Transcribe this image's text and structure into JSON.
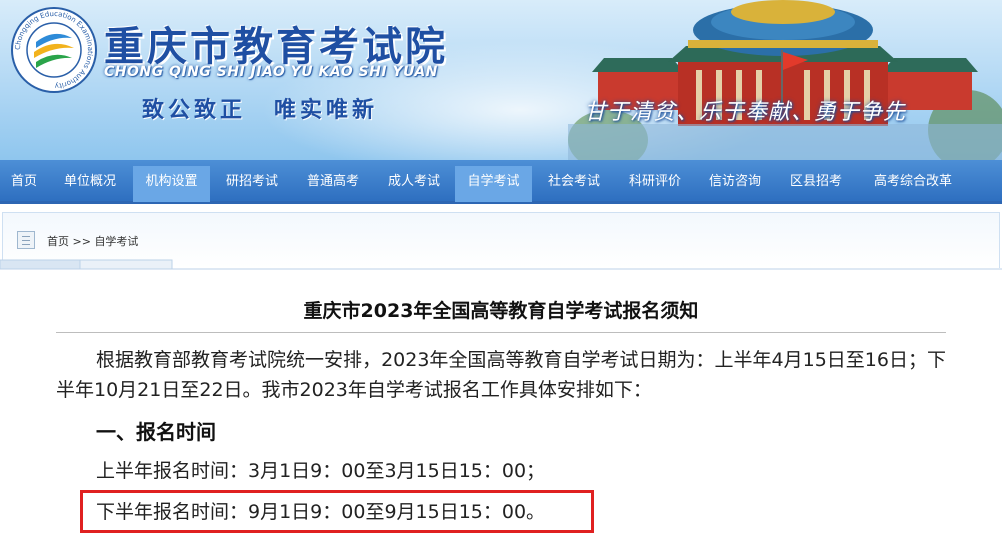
{
  "header": {
    "site_title": "重庆市教育考试院",
    "site_pinyin": "CHONG QING SHI JIAO YU KAO SHI YUAN",
    "motto_left": "致公致正",
    "motto_right": "唯实唯新",
    "slogan": "甘于清贫、乐于奉献、勇于争先",
    "logo_ring_text": "Chongqing Education Examinations Authority",
    "colors": {
      "title": "#1f4fa3",
      "nav": "#2e6fc0",
      "nav_active": "#6aa7e6"
    }
  },
  "nav": {
    "items": [
      {
        "label": "首页",
        "active": false
      },
      {
        "label": "单位概况",
        "active": false
      },
      {
        "label": "机构设置",
        "active": true
      },
      {
        "label": "研招考试",
        "active": false
      },
      {
        "label": "普通高考",
        "active": false
      },
      {
        "label": "成人考试",
        "active": false
      },
      {
        "label": "自学考试",
        "active": true
      },
      {
        "label": "社会考试",
        "active": false
      },
      {
        "label": "科研评价",
        "active": false
      },
      {
        "label": "信访咨询",
        "active": false
      },
      {
        "label": "区县招考",
        "active": false
      },
      {
        "label": "高考综合改革",
        "active": false
      }
    ]
  },
  "breadcrumb": {
    "home": "首页",
    "separator": ">>",
    "current": "自学考试",
    "icon": "page-icon"
  },
  "article": {
    "title": "重庆市2023年全国高等教育自学考试报名须知",
    "intro": "根据教育部教育考试院统一安排，2023年全国高等教育自学考试日期为：上半年4月15日至16日；下半年10月21日至22日。我市2023年自学考试报名工作具体安排如下：",
    "section1_heading": "一、报名时间",
    "first_half": "上半年报名时间：3月1日9：00至3月15日15：00；",
    "second_half": "下半年报名时间：9月1日9：00至9月15日15：00。",
    "highlight_color": "#e02020"
  }
}
